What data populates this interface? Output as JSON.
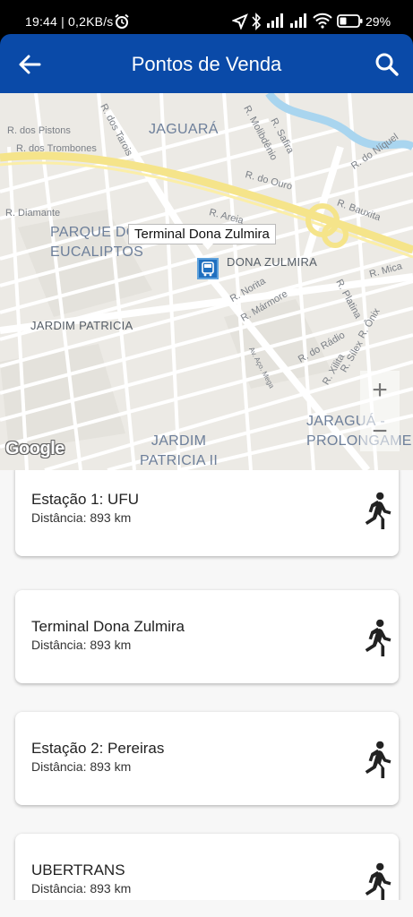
{
  "status_bar": {
    "time_speed": "19:44 | 0,2KB/s",
    "battery": "29%"
  },
  "app_bar": {
    "title": "Pontos de Venda",
    "back_icon": "arrow-back-icon",
    "search_icon": "search-icon",
    "color": "#0a4aa8"
  },
  "map": {
    "street_labels": {
      "pistons": "R. dos Pistons",
      "trombones": "R. dos Trombones",
      "tarois": "R. dos Tarois",
      "molibdenio": "R. Molibdênio",
      "safira": "R. Safira",
      "niquel": "R. do Níquel",
      "ouro": "R. do Ouro",
      "diamante": "R. Diamante",
      "areia": "R. Areia",
      "bauxita": "R. Bauxita",
      "mica": "R. Mica",
      "norita": "R. Norita",
      "marmore": "R. Mármore",
      "platina": "R. Platina",
      "radio": "R. do Rádio",
      "onix": "R. Ônix",
      "silex": "R. Sílex",
      "xilita": "R. Xilita",
      "mega": "Av. Aço. Mega"
    },
    "area_labels": {
      "jaguara": "JAGUARÁ",
      "parque": "PARQUE DOS\nEUCALIPTOS",
      "dona_zulmira": "DONA ZULMIRA",
      "jardim_patricia": "JARDIM PATRICIA",
      "jardim_patricia_ii": "JARDIM\nPATRICIA II",
      "jaragua": "JARAGUÁ -\nPROLONGAME"
    },
    "marker_tooltip": "Terminal Dona Zulmira",
    "zoom_in": "+",
    "zoom_out": "−",
    "attribution": "Google"
  },
  "points": [
    {
      "name": "Estação 1: UFU",
      "distance": "Distância: 893 km"
    },
    {
      "name": "Terminal Dona Zulmira",
      "distance": "Distância: 893 km"
    },
    {
      "name": "Estação 2: Pereiras",
      "distance": "Distância: 893 km"
    },
    {
      "name": "UBERTRANS",
      "distance": "Distância: 893 km"
    }
  ]
}
